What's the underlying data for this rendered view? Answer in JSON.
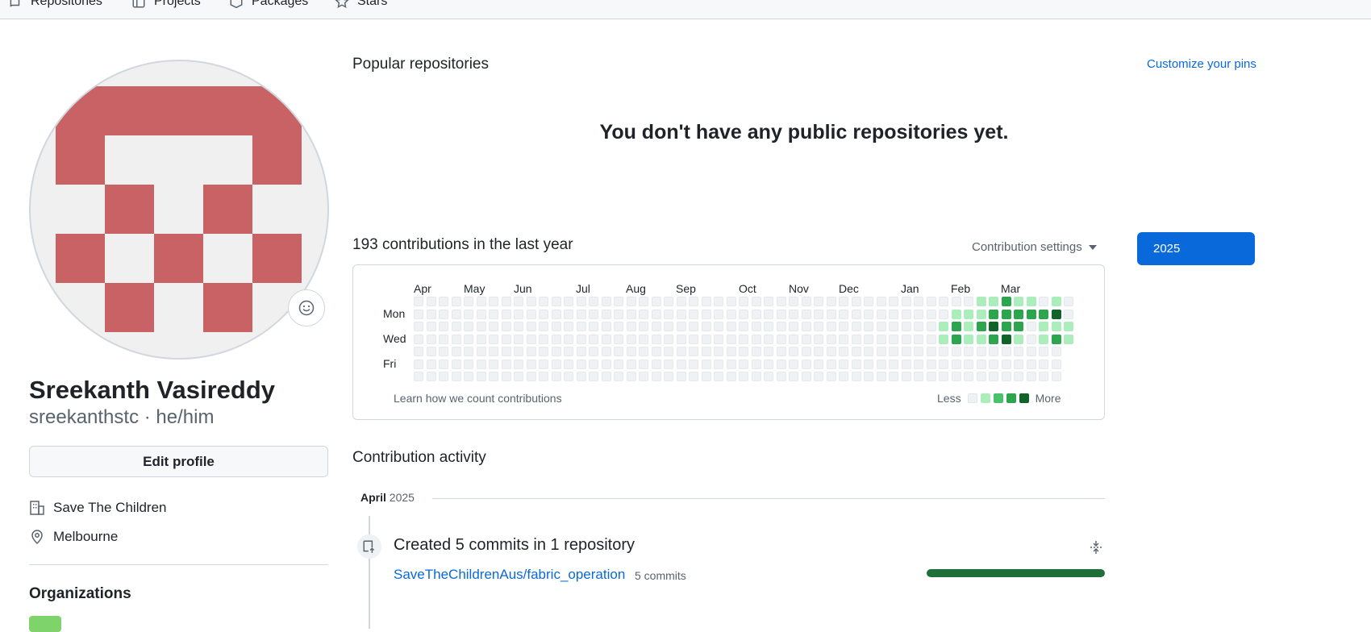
{
  "nav": {
    "tabs": [
      {
        "label": "Repositories",
        "icon": "repo-icon"
      },
      {
        "label": "Projects",
        "icon": "project-icon"
      },
      {
        "label": "Packages",
        "icon": "package-icon"
      },
      {
        "label": "Stars",
        "icon": "star-icon"
      }
    ]
  },
  "profile": {
    "name": "Sreekanth Vasireddy",
    "login_pronouns": "sreekanthstc · he/him",
    "edit_label": "Edit profile",
    "company": "Save The Children",
    "location": "Melbourne",
    "organizations_title": "Organizations",
    "avatar_color": "#c96264"
  },
  "popular": {
    "title": "Popular repositories",
    "customize_label": "Customize your pins",
    "empty_message": "You don't have any public repositories yet."
  },
  "contributions": {
    "title": "193 contributions in the last year",
    "settings_label": "Contribution settings",
    "year_button": "2025",
    "months": [
      "Apr",
      "May",
      "Jun",
      "Jul",
      "Aug",
      "Sep",
      "Oct",
      "Nov",
      "Dec",
      "Jan",
      "Feb",
      "Mar"
    ],
    "day_labels": [
      "Mon",
      "Wed",
      "Fri"
    ],
    "learn_label": "Learn how we count contributions",
    "legend_less": "Less",
    "legend_more": "More",
    "level_colors": [
      "#eff2f5",
      "#aceebb",
      "#4ac26b",
      "#2da44e",
      "#116329"
    ]
  },
  "activity": {
    "title": "Contribution activity",
    "month": "April",
    "year": "2025",
    "event_title": "Created 5 commits in 1 repository",
    "repo_name": "SaveTheChildrenAus/fabric_operation",
    "repo_commits": "5 commits"
  }
}
